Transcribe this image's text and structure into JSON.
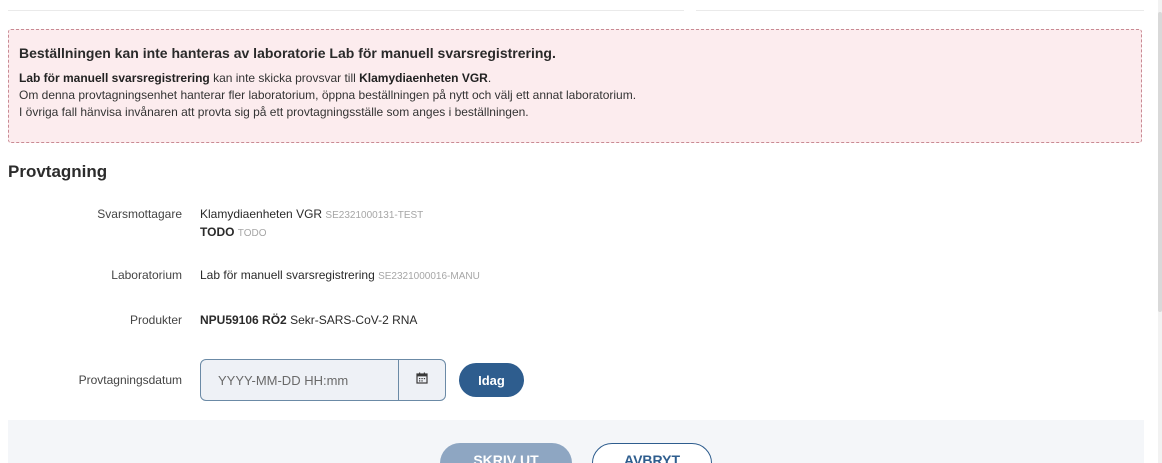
{
  "alert": {
    "title": "Beställningen kan inte hanteras av laboratorie Lab för manuell svarsregistrering.",
    "line1_bold_lab": "Lab för manuell svarsregistrering",
    "line1_middle": " kan inte skicka provsvar till ",
    "line1_bold_unit": "Klamydiaenheten VGR",
    "line1_end": ".",
    "line2": "Om denna provtagningsenhet hanterar fler laboratorium, öppna beställningen på nytt och välj ett annat laboratorium.",
    "line3": "I övriga fall hänvisa invånaren att provta sig på ett provtagningsställe som anges i beställningen.",
    "accent_color": "#fcecee"
  },
  "section": {
    "title": "Provtagning"
  },
  "recipient": {
    "label": "Svarsmottagare",
    "name": "Klamydiaenheten VGR",
    "id": "SE2321000131-TEST",
    "todo_label": "TODO",
    "todo_value": "TODO"
  },
  "laboratory": {
    "label": "Laboratorium",
    "name": "Lab för manuell svarsregistrering",
    "id": "SE2321000016-MANU"
  },
  "products": {
    "label": "Produkter",
    "code": "NPU59106 RÖ2",
    "name": "Sekr-SARS-CoV-2 RNA"
  },
  "sampling_date": {
    "label": "Provtagningsdatum",
    "placeholder": "YYYY-MM-DD HH:mm",
    "value": "",
    "calendar_icon": "calendar-icon",
    "today_label": "Idag"
  },
  "footer": {
    "print_label": "SKRIV UT",
    "cancel_label": "AVBRYT"
  },
  "colors": {
    "primary": "#2e5d8e",
    "primary_disabled": "#8ea6c2",
    "alert_border": "#c98a93"
  }
}
